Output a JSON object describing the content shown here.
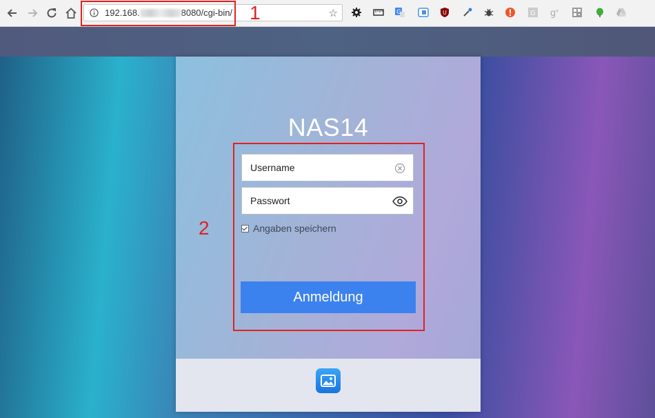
{
  "browser": {
    "url_prefix": "192.168.",
    "url_suffix": "8080/cgi-bin/"
  },
  "annotations": {
    "label_1": "1",
    "label_2": "2",
    "color": "#e32020"
  },
  "login": {
    "device_name": "NAS14",
    "username_placeholder": "Username",
    "password_placeholder": "Passwort",
    "remember_label": "Angaben speichern",
    "remember_checked": true,
    "login_button": "Anmeldung"
  },
  "colors": {
    "button_blue": "#3c82ee",
    "footer_icon_blue": "#1a74e0"
  },
  "icons": {
    "nav": [
      "back-icon",
      "forward-icon",
      "reload-icon",
      "home-icon"
    ],
    "extensions": [
      "gear-icon",
      "ruler-icon",
      "translate-icon",
      "extension-icon",
      "ublock-icon",
      "eyedropper-icon",
      "bug-icon",
      "alert-icon",
      "grammarly-icon",
      "google-icon",
      "qr-icon",
      "evernote-icon",
      "drive-icon"
    ]
  }
}
